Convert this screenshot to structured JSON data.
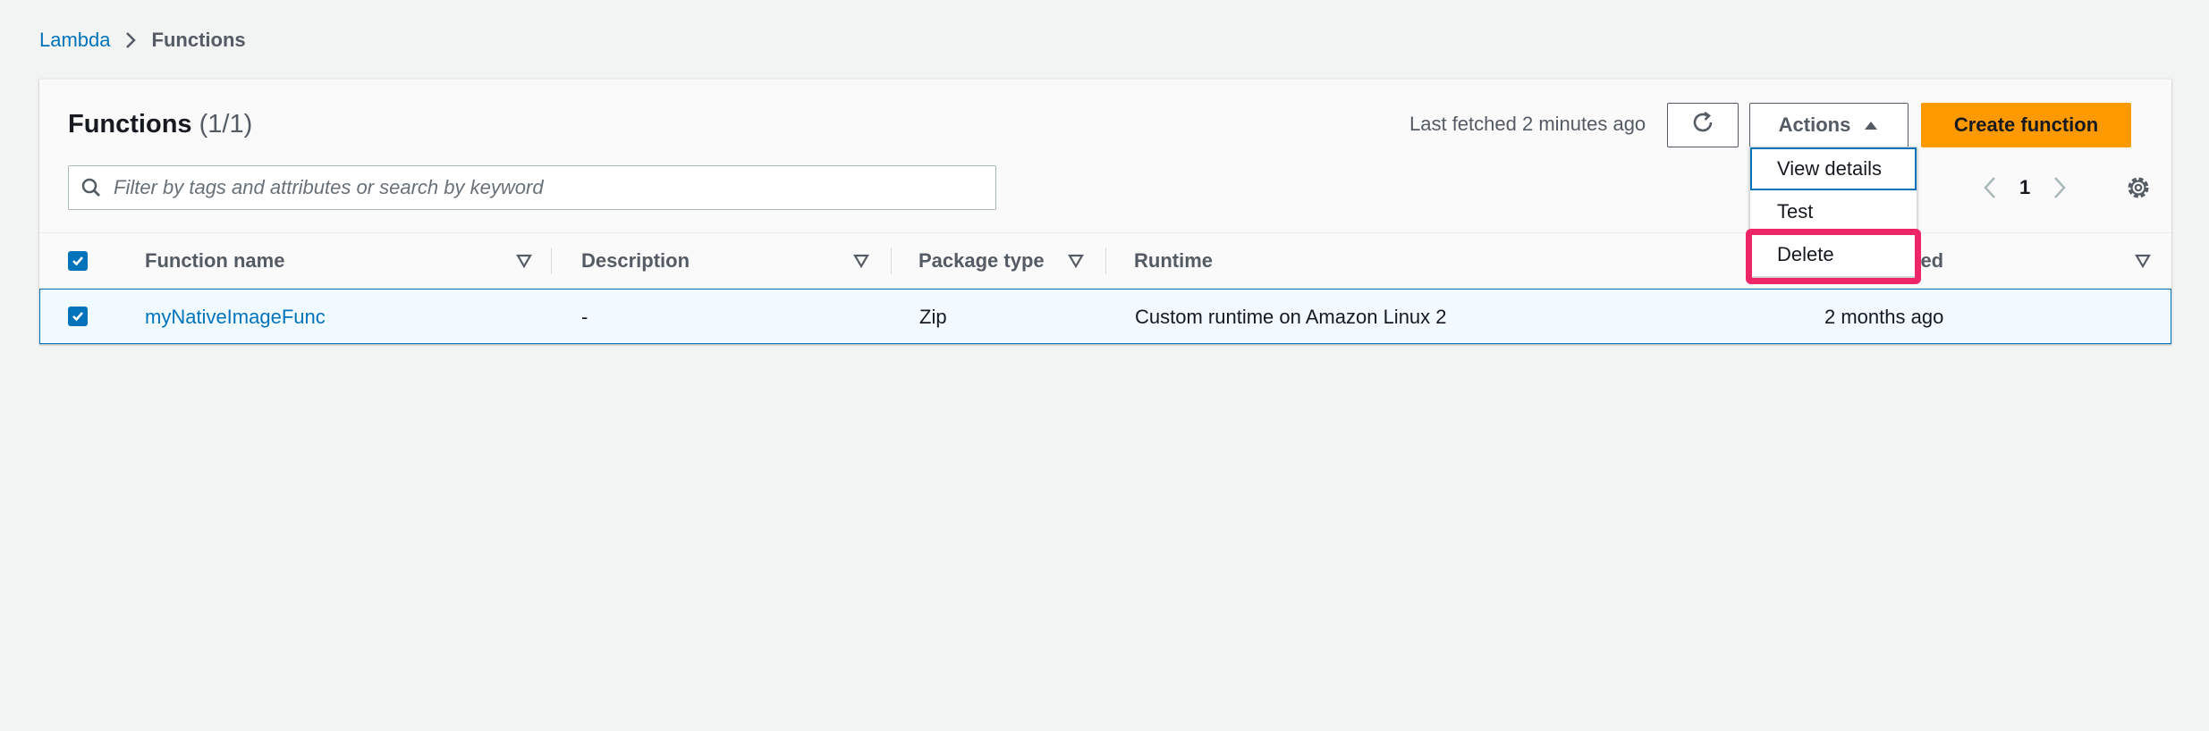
{
  "breadcrumb": {
    "root": "Lambda",
    "current": "Functions"
  },
  "header": {
    "title": "Functions",
    "count": "(1/1)",
    "last_fetched": "Last fetched 2 minutes ago",
    "actions_label": "Actions",
    "create_label": "Create function"
  },
  "search": {
    "placeholder": "Filter by tags and attributes or search by keyword"
  },
  "pagination": {
    "page": "1"
  },
  "columns": {
    "name": "Function name",
    "description": "Description",
    "package_type": "Package type",
    "runtime": "Runtime",
    "last_modified_partial": "fied"
  },
  "rows": [
    {
      "name": "myNativeImageFunc",
      "description": "-",
      "package_type": "Zip",
      "runtime": "Custom runtime on Amazon Linux 2",
      "last_modified": "2 months ago"
    }
  ],
  "actions_menu": [
    "View details",
    "Test",
    "Delete"
  ],
  "colors": {
    "link": "#0073bb",
    "primary_button": "#ff9900",
    "highlight": "#ee2566",
    "selected_row": "#f1faff"
  }
}
